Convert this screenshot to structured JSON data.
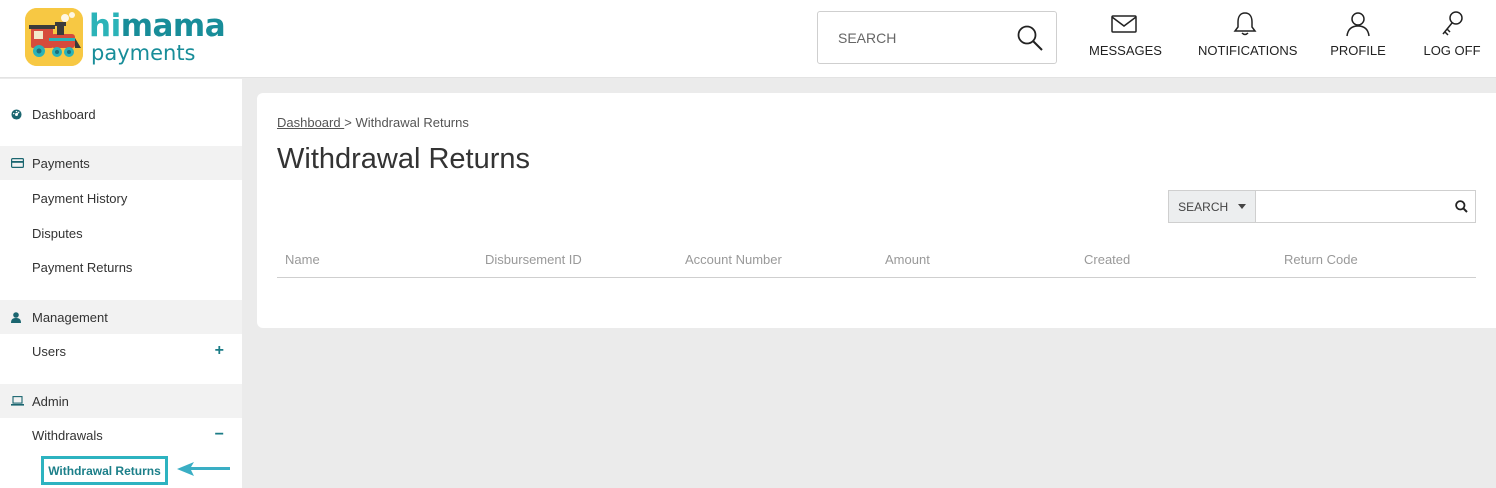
{
  "header": {
    "logo": {
      "line1_a": "hi",
      "line1_b": "mama",
      "line2": "payments"
    },
    "search": {
      "placeholder": "SEARCH",
      "value": ""
    },
    "nav": [
      {
        "label": "MESSAGES",
        "icon": "envelope-icon"
      },
      {
        "label": "NOTIFICATIONS",
        "icon": "bell-icon"
      },
      {
        "label": "PROFILE",
        "icon": "user-icon"
      },
      {
        "label": "LOG OFF",
        "icon": "key-icon"
      }
    ]
  },
  "sidebar": {
    "items": [
      {
        "label": "Dashboard",
        "icon": "dashboard-icon"
      },
      {
        "label": "Payments",
        "icon": "credit-card-icon"
      },
      {
        "label": "Payment History"
      },
      {
        "label": "Disputes"
      },
      {
        "label": "Payment Returns"
      },
      {
        "label": "Management",
        "icon": "person-icon"
      },
      {
        "label": "Users",
        "toggle": "+"
      },
      {
        "label": "Admin",
        "icon": "laptop-icon"
      },
      {
        "label": "Withdrawals",
        "toggle": "−"
      }
    ],
    "active": "Withdrawal Returns"
  },
  "main": {
    "breadcrumb": {
      "link": "Dashboard ",
      "separator": ">",
      "current": "Withdrawal Returns"
    },
    "title": "Withdrawal Returns",
    "search": {
      "dropdown_label": "SEARCH",
      "placeholder": "",
      "value": ""
    },
    "table": {
      "columns": [
        "Name",
        "Disbursement ID",
        "Account Number",
        "Amount",
        "Created",
        "Return Code"
      ],
      "rows": []
    }
  },
  "colors": {
    "accent": "#1b7c86",
    "highlight": "#2db3c0",
    "logo_bg": "#f7c843"
  }
}
